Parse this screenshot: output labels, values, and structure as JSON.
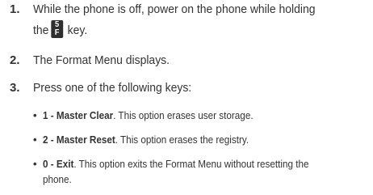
{
  "steps": [
    {
      "number": "1.",
      "line1": "While the phone is off, power on the phone while holding",
      "line2_pre": "the",
      "key_glyph_top": "5",
      "key_glyph_bottom": "F",
      "line2_post": "key."
    },
    {
      "number": "2.",
      "text": "The Format Menu displays."
    },
    {
      "number": "3.",
      "text": "Press one of the following keys:"
    }
  ],
  "options": [
    {
      "bullet": "•",
      "label": "1 - Master Clear",
      "desc": ". This option erases user storage."
    },
    {
      "bullet": "•",
      "label": "2 - Master Reset",
      "desc": ". This option erases the registry."
    },
    {
      "bullet": "•",
      "label": "0 - Exit",
      "desc": ". This option exits the Format Menu without resetting the",
      "desc_line2": "phone."
    }
  ]
}
